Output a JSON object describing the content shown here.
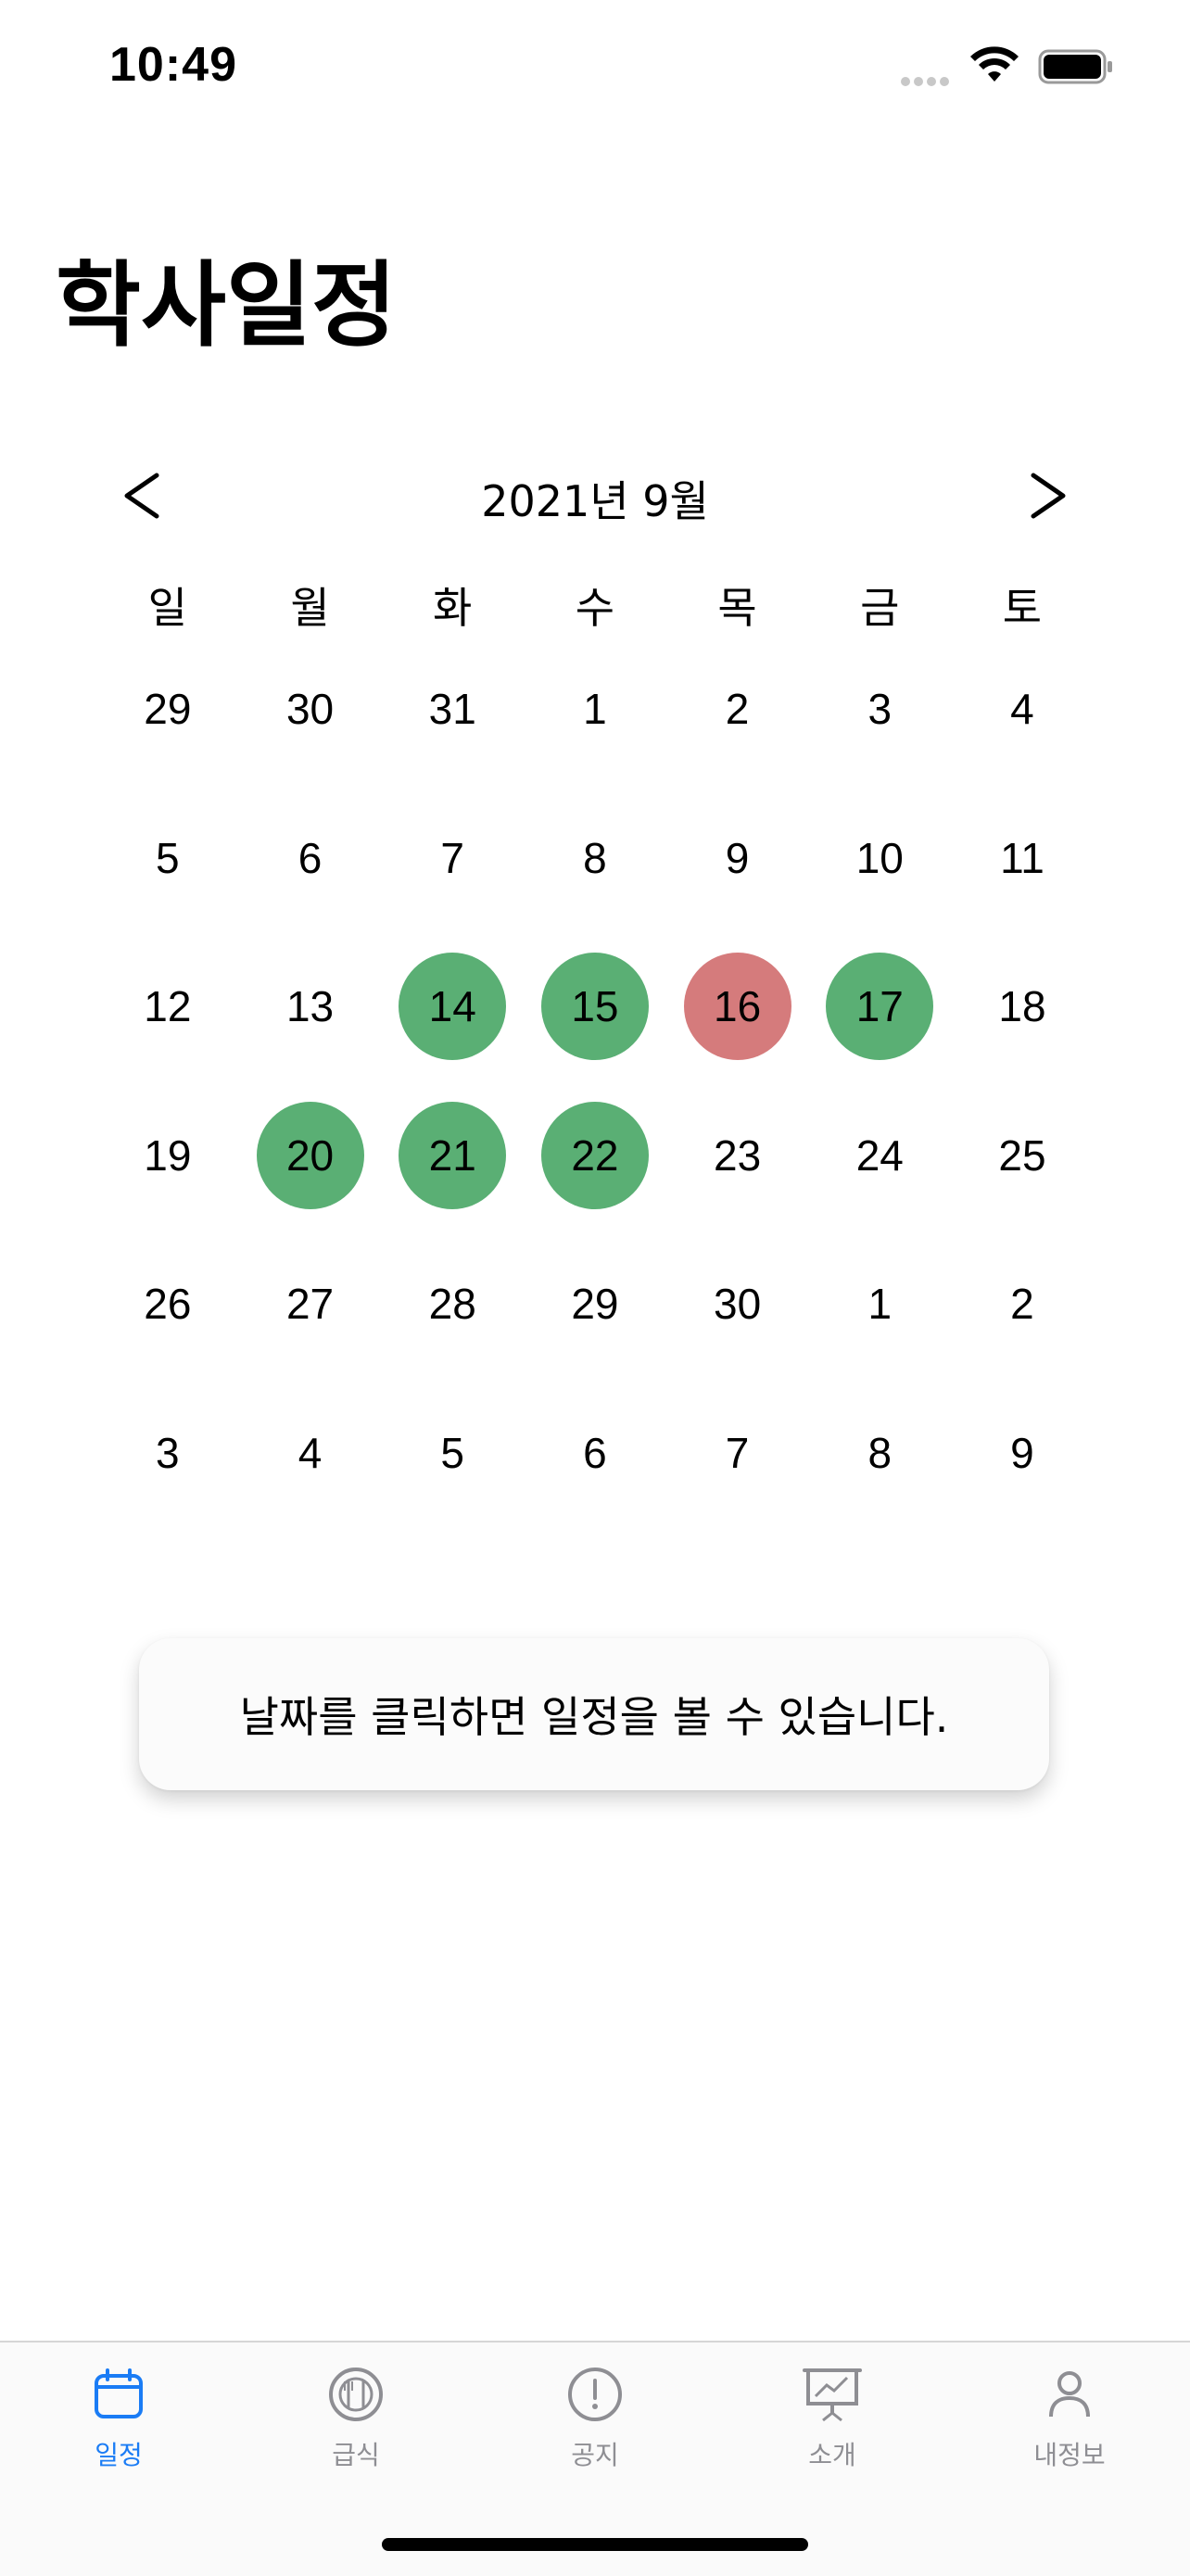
{
  "status_bar": {
    "time": "10:49"
  },
  "header": {
    "title": "학사일정"
  },
  "calendar": {
    "month_label": "2021년 9월",
    "weekdays": [
      "일",
      "월",
      "화",
      "수",
      "목",
      "금",
      "토"
    ],
    "days": [
      {
        "n": "29",
        "m": "other"
      },
      {
        "n": "30",
        "m": "other"
      },
      {
        "n": "31",
        "m": "other"
      },
      {
        "n": "1"
      },
      {
        "n": "2"
      },
      {
        "n": "3"
      },
      {
        "n": "4"
      },
      {
        "n": "5"
      },
      {
        "n": "6"
      },
      {
        "n": "7"
      },
      {
        "n": "8"
      },
      {
        "n": "9"
      },
      {
        "n": "10"
      },
      {
        "n": "11"
      },
      {
        "n": "12"
      },
      {
        "n": "13"
      },
      {
        "n": "14",
        "mark": "green"
      },
      {
        "n": "15",
        "mark": "green"
      },
      {
        "n": "16",
        "mark": "red"
      },
      {
        "n": "17",
        "mark": "green"
      },
      {
        "n": "18"
      },
      {
        "n": "19"
      },
      {
        "n": "20",
        "mark": "green"
      },
      {
        "n": "21",
        "mark": "green"
      },
      {
        "n": "22",
        "mark": "green"
      },
      {
        "n": "23"
      },
      {
        "n": "24"
      },
      {
        "n": "25"
      },
      {
        "n": "26"
      },
      {
        "n": "27"
      },
      {
        "n": "28"
      },
      {
        "n": "29"
      },
      {
        "n": "30"
      },
      {
        "n": "1",
        "m": "other"
      },
      {
        "n": "2",
        "m": "other"
      },
      {
        "n": "3",
        "m": "other"
      },
      {
        "n": "4",
        "m": "other"
      },
      {
        "n": "5",
        "m": "other"
      },
      {
        "n": "6",
        "m": "other"
      },
      {
        "n": "7",
        "m": "other"
      },
      {
        "n": "8",
        "m": "other"
      },
      {
        "n": "9",
        "m": "other"
      }
    ],
    "colors": {
      "green": "#5aaf74",
      "red": "#d57b7c"
    }
  },
  "hint": {
    "text": "날짜를 클릭하면 일정을 볼 수 있습니다."
  },
  "tab_bar": {
    "active_color": "#1a7cf5",
    "inactive_color": "#8e8e93",
    "items": [
      {
        "label": "일정",
        "icon": "calendar-icon",
        "active": true
      },
      {
        "label": "급식",
        "icon": "meal-icon",
        "active": false
      },
      {
        "label": "공지",
        "icon": "notice-icon",
        "active": false
      },
      {
        "label": "소개",
        "icon": "presentation-icon",
        "active": false
      },
      {
        "label": "내정보",
        "icon": "profile-icon",
        "active": false
      }
    ]
  }
}
